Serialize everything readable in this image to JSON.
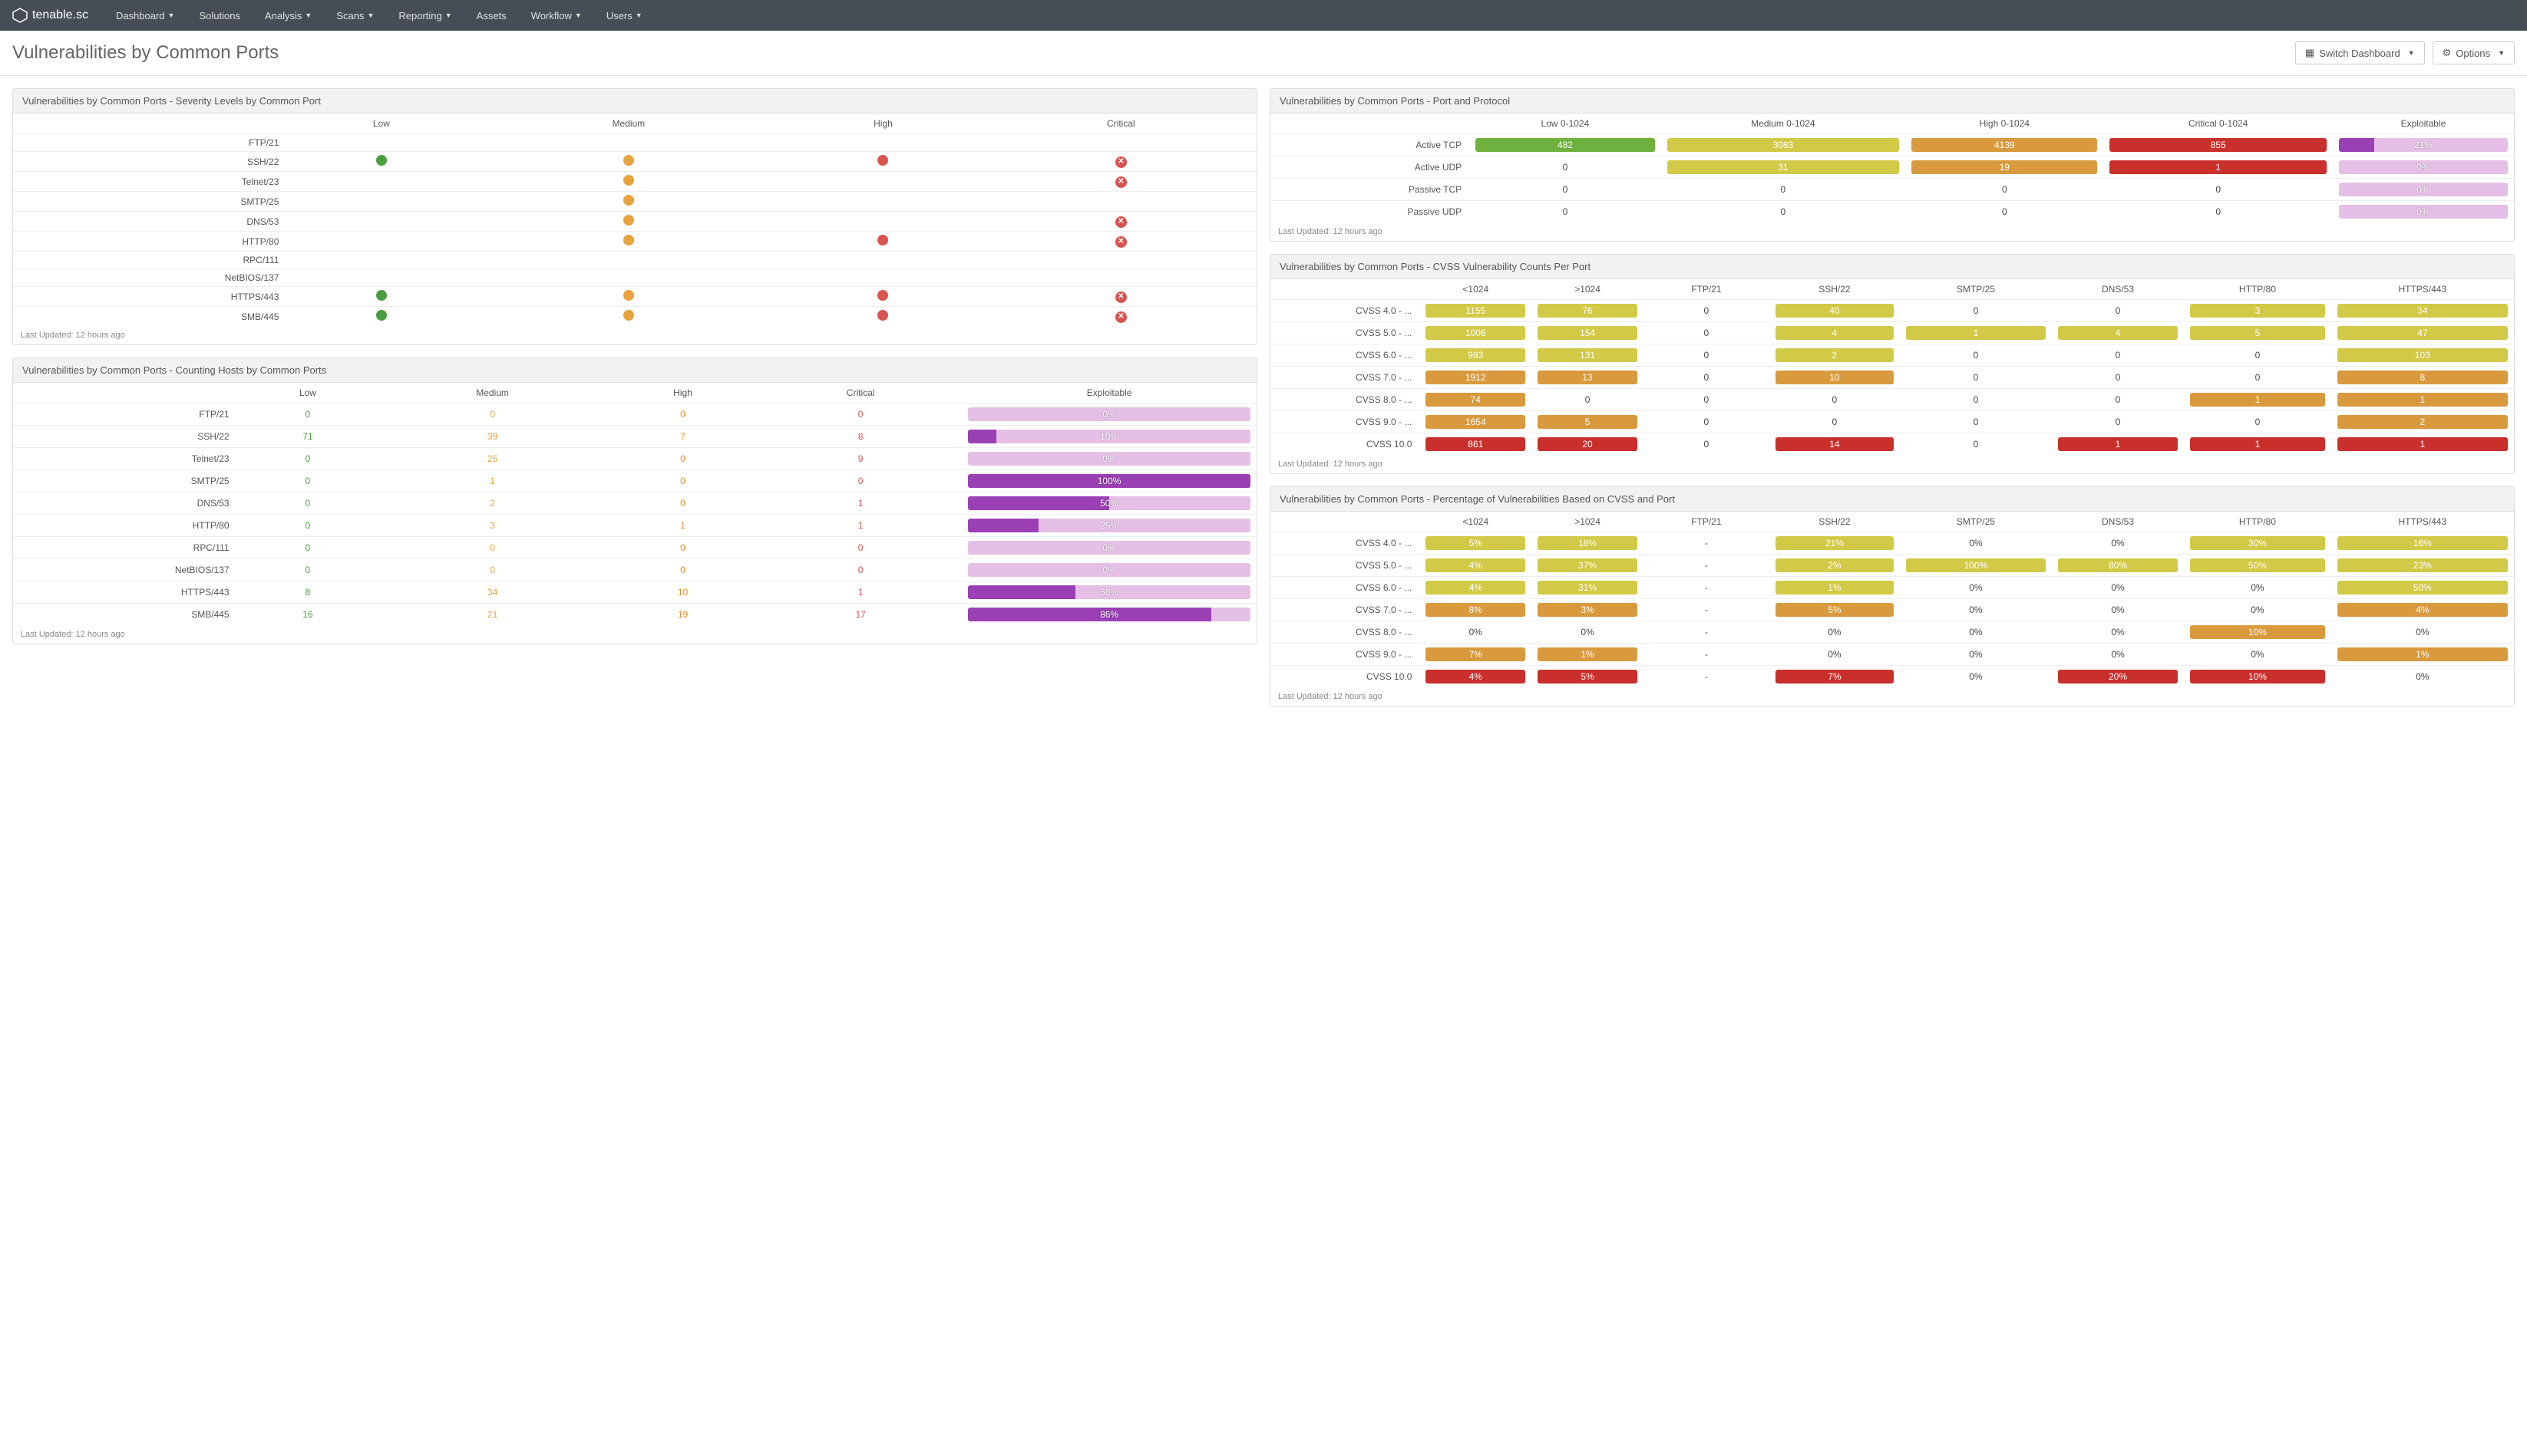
{
  "brand": "tenable.sc",
  "nav": [
    "Dashboard",
    "Solutions",
    "Analysis",
    "Scans",
    "Reporting",
    "Assets",
    "Workflow",
    "Users"
  ],
  "nav_has_caret": [
    true,
    false,
    true,
    true,
    true,
    false,
    true,
    true
  ],
  "page_title": "Vulnerabilities by Common Ports",
  "buttons": {
    "switch": "Switch Dashboard",
    "options": "Options"
  },
  "last_updated": "Last Updated: 12 hours ago",
  "panel1": {
    "title": "Vulnerabilities by Common Ports - Severity Levels by Common Port",
    "cols": [
      "Low",
      "Medium",
      "High",
      "Critical"
    ],
    "rows": [
      {
        "label": "FTP/21",
        "c": [
          "",
          "",
          "",
          ""
        ]
      },
      {
        "label": "SSH/22",
        "c": [
          "low",
          "med",
          "high",
          "crit"
        ]
      },
      {
        "label": "Telnet/23",
        "c": [
          "",
          "med",
          "",
          "crit"
        ]
      },
      {
        "label": "SMTP/25",
        "c": [
          "",
          "med",
          "",
          ""
        ]
      },
      {
        "label": "DNS/53",
        "c": [
          "",
          "med",
          "",
          "crit"
        ]
      },
      {
        "label": "HTTP/80",
        "c": [
          "",
          "med",
          "high",
          "crit"
        ]
      },
      {
        "label": "RPC/111",
        "c": [
          "",
          "",
          "",
          ""
        ]
      },
      {
        "label": "NetBIOS/137",
        "c": [
          "",
          "",
          "",
          ""
        ]
      },
      {
        "label": "HTTPS/443",
        "c": [
          "low",
          "med",
          "high",
          "crit"
        ]
      },
      {
        "label": "SMB/445",
        "c": [
          "low",
          "med",
          "high",
          "crit"
        ]
      }
    ]
  },
  "panel2": {
    "title": "Vulnerabilities by Common Ports - Counting Hosts by Common Ports",
    "cols": [
      "Low",
      "Medium",
      "High",
      "Critical",
      "Exploitable"
    ],
    "rows": [
      {
        "label": "FTP/21",
        "v": [
          0,
          0,
          0,
          0
        ],
        "expl": 0
      },
      {
        "label": "SSH/22",
        "v": [
          71,
          39,
          7,
          8
        ],
        "expl": 10
      },
      {
        "label": "Telnet/23",
        "v": [
          0,
          25,
          0,
          9
        ],
        "expl": 0
      },
      {
        "label": "SMTP/25",
        "v": [
          0,
          1,
          0,
          0
        ],
        "expl": 100
      },
      {
        "label": "DNS/53",
        "v": [
          0,
          2,
          0,
          1
        ],
        "expl": 50
      },
      {
        "label": "HTTP/80",
        "v": [
          0,
          3,
          1,
          1
        ],
        "expl": 25
      },
      {
        "label": "RPC/111",
        "v": [
          0,
          0,
          0,
          0
        ],
        "expl": 0
      },
      {
        "label": "NetBIOS/137",
        "v": [
          0,
          0,
          0,
          0
        ],
        "expl": 0
      },
      {
        "label": "HTTPS/443",
        "v": [
          8,
          34,
          10,
          1
        ],
        "expl": 38
      },
      {
        "label": "SMB/445",
        "v": [
          16,
          21,
          19,
          17
        ],
        "expl": 86
      }
    ]
  },
  "panel3": {
    "title": "Vulnerabilities by Common Ports - Port and Protocol",
    "cols": [
      "Low 0-1024",
      "Medium 0-1024",
      "High 0-1024",
      "Critical 0-1024",
      "Exploitable"
    ],
    "rows": [
      {
        "label": "Active TCP",
        "v": [
          482,
          3083,
          4139,
          855
        ],
        "style": [
          "green",
          "yellow",
          "orange",
          "red"
        ],
        "expl": 21
      },
      {
        "label": "Active UDP",
        "v": [
          0,
          31,
          19,
          1
        ],
        "style": [
          "plain",
          "yellow",
          "orange",
          "red"
        ],
        "expl": 0
      },
      {
        "label": "Passive TCP",
        "v": [
          0,
          0,
          0,
          0
        ],
        "style": [
          "plain",
          "plain",
          "plain",
          "plain"
        ],
        "expl": 0
      },
      {
        "label": "Passive UDP",
        "v": [
          0,
          0,
          0,
          0
        ],
        "style": [
          "plain",
          "plain",
          "plain",
          "plain"
        ],
        "expl": 0
      }
    ]
  },
  "panel4": {
    "title": "Vulnerabilities by Common Ports - CVSS Vulnerability Counts Per Port",
    "cols": [
      "<1024",
      ">1024",
      "FTP/21",
      "SSH/22",
      "SMTP/25",
      "DNS/53",
      "HTTP/80",
      "HTTPS/443"
    ],
    "rows": [
      {
        "label": "CVSS 4.0 - ...",
        "v": [
          1155,
          76,
          0,
          40,
          0,
          0,
          3,
          34
        ],
        "style": [
          "yellow",
          "yellow",
          "plain",
          "yellow",
          "plain",
          "plain",
          "yellow",
          "yellow"
        ]
      },
      {
        "label": "CVSS 5.0 - ...",
        "v": [
          1006,
          154,
          0,
          4,
          1,
          4,
          5,
          47
        ],
        "style": [
          "yellow",
          "yellow",
          "plain",
          "yellow",
          "yellow",
          "yellow",
          "yellow",
          "yellow"
        ]
      },
      {
        "label": "CVSS 6.0 - ...",
        "v": [
          983,
          131,
          0,
          2,
          0,
          0,
          0,
          103
        ],
        "style": [
          "yellow",
          "yellow",
          "plain",
          "yellow",
          "plain",
          "plain",
          "plain",
          "yellow"
        ]
      },
      {
        "label": "CVSS 7.0 - ...",
        "v": [
          1912,
          13,
          0,
          10,
          0,
          0,
          0,
          8
        ],
        "style": [
          "orange",
          "orange",
          "plain",
          "orange",
          "plain",
          "plain",
          "plain",
          "orange"
        ]
      },
      {
        "label": "CVSS 8.0 - ...",
        "v": [
          74,
          0,
          0,
          0,
          0,
          0,
          1,
          1
        ],
        "style": [
          "orange",
          "plain",
          "plain",
          "plain",
          "plain",
          "plain",
          "orange",
          "orange"
        ]
      },
      {
        "label": "CVSS 9.0 - ...",
        "v": [
          1654,
          5,
          0,
          0,
          0,
          0,
          0,
          2
        ],
        "style": [
          "orange",
          "orange",
          "plain",
          "plain",
          "plain",
          "plain",
          "plain",
          "orange"
        ]
      },
      {
        "label": "CVSS 10.0",
        "v": [
          861,
          20,
          0,
          14,
          0,
          1,
          1,
          1
        ],
        "style": [
          "red",
          "red",
          "plain",
          "red",
          "plain",
          "red",
          "red",
          "red"
        ]
      }
    ]
  },
  "panel5": {
    "title": "Vulnerabilities by Common Ports - Percentage of Vulnerabilities Based on CVSS and Port",
    "cols": [
      "<1024",
      ">1024",
      "FTP/21",
      "SSH/22",
      "SMTP/25",
      "DNS/53",
      "HTTP/80",
      "HTTPS/443"
    ],
    "rows": [
      {
        "label": "CVSS 4.0 - ...",
        "v": [
          "5%",
          "18%",
          "-",
          "21%",
          "0%",
          "0%",
          "30%",
          "16%"
        ],
        "style": [
          "yellow",
          "yellow",
          "plain",
          "yellow",
          "plain",
          "plain",
          "yellow",
          "yellow"
        ]
      },
      {
        "label": "CVSS 5.0 - ...",
        "v": [
          "4%",
          "37%",
          "-",
          "2%",
          "100%",
          "80%",
          "50%",
          "23%"
        ],
        "style": [
          "yellow",
          "yellow",
          "plain",
          "yellow",
          "yellow",
          "yellow",
          "yellow",
          "yellow"
        ]
      },
      {
        "label": "CVSS 6.0 - ...",
        "v": [
          "4%",
          "31%",
          "-",
          "1%",
          "0%",
          "0%",
          "0%",
          "50%"
        ],
        "style": [
          "yellow",
          "yellow",
          "plain",
          "yellow",
          "plain",
          "plain",
          "plain",
          "yellow"
        ]
      },
      {
        "label": "CVSS 7.0 - ...",
        "v": [
          "8%",
          "3%",
          "-",
          "5%",
          "0%",
          "0%",
          "0%",
          "4%"
        ],
        "style": [
          "orange",
          "orange",
          "plain",
          "orange",
          "plain",
          "plain",
          "plain",
          "orange"
        ]
      },
      {
        "label": "CVSS 8.0 - ...",
        "v": [
          "0%",
          "0%",
          "-",
          "0%",
          "0%",
          "0%",
          "10%",
          "0%"
        ],
        "style": [
          "plain",
          "plain",
          "plain",
          "plain",
          "plain",
          "plain",
          "orange",
          "plain"
        ]
      },
      {
        "label": "CVSS 9.0 - ...",
        "v": [
          "7%",
          "1%",
          "-",
          "0%",
          "0%",
          "0%",
          "0%",
          "1%"
        ],
        "style": [
          "orange",
          "orange",
          "plain",
          "plain",
          "plain",
          "plain",
          "plain",
          "orange"
        ]
      },
      {
        "label": "CVSS 10.0",
        "v": [
          "4%",
          "5%",
          "-",
          "7%",
          "0%",
          "20%",
          "10%",
          "0%"
        ],
        "style": [
          "red",
          "red",
          "plain",
          "red",
          "plain",
          "red",
          "red",
          "plain"
        ]
      }
    ]
  }
}
